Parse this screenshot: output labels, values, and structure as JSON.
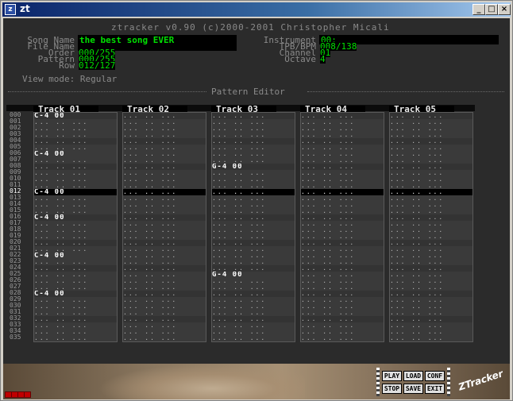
{
  "window": {
    "title": "zt",
    "min_label": "_",
    "max_label": "□",
    "close_label": "×"
  },
  "header": {
    "title": "ztracker v0.90 (c)2000-2001 Christopher Micali",
    "song_name_label": "Song Name",
    "song_name": "the best song EVER",
    "file_name_label": "File Name",
    "file_name": "",
    "order_label": "Order",
    "order": "000/255",
    "pattern_label": "Pattern",
    "pattern": "000/255",
    "row_label": "Row",
    "row": "012/127",
    "instrument_label": "Instrument",
    "instrument": "00:",
    "tpb_label": "TPB/BPM",
    "tpb": "008/138",
    "channel_label": "Channel",
    "channel": "01",
    "octave_label": "Octave",
    "octave": "4",
    "view_mode": "View mode: Regular",
    "section_title": "Pattern Editor"
  },
  "tracks": [
    "Track 01",
    "Track 02",
    "Track 03",
    "Track 04",
    "Track 05"
  ],
  "rows": [
    "000",
    "001",
    "002",
    "003",
    "004",
    "005",
    "006",
    "007",
    "008",
    "009",
    "010",
    "011",
    "012",
    "013",
    "014",
    "015",
    "016",
    "017",
    "018",
    "019",
    "020",
    "021",
    "022",
    "023",
    "024",
    "025",
    "026",
    "027",
    "028",
    "029",
    "030",
    "031",
    "032",
    "033",
    "034",
    "035"
  ],
  "current_row": 12,
  "empty_cell": "... .. ...",
  "notes": [
    {
      "track": 0,
      "row": 0,
      "text": "C-4 00"
    },
    {
      "track": 0,
      "row": 6,
      "text": "C-4 00"
    },
    {
      "track": 0,
      "row": 12,
      "text": "C-4 00"
    },
    {
      "track": 0,
      "row": 16,
      "text": "C-4 00"
    },
    {
      "track": 0,
      "row": 22,
      "text": "C-4 00"
    },
    {
      "track": 0,
      "row": 28,
      "text": "C-4 00"
    },
    {
      "track": 2,
      "row": 8,
      "text": "G-4 00"
    },
    {
      "track": 2,
      "row": 25,
      "text": "G-4 00"
    }
  ],
  "controls": {
    "play": "PLAY",
    "load": "LOAD",
    "conf": "CONF",
    "stop": "STOP",
    "save": "SAVE",
    "exit": "EXIT",
    "logo": "ZTracker"
  }
}
